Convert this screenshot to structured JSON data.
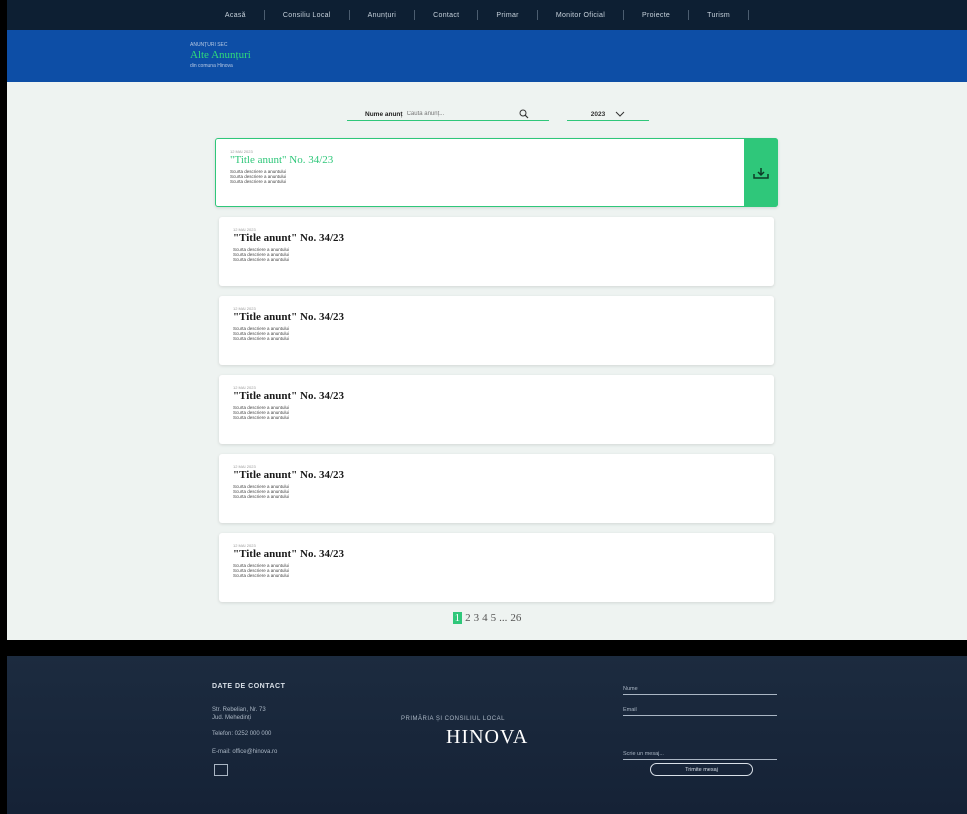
{
  "nav": [
    "Acasă",
    "Consiliu Local",
    "Anunțuri",
    "Contact",
    "Primar",
    "Monitor Oficial",
    "Proiecte",
    "Turism"
  ],
  "hero": {
    "kicker": "ANUNȚURI SEC",
    "title": "Alte Anunțuri",
    "sub": "din comuna Hinova"
  },
  "search": {
    "label": "Nume anunț",
    "placeholder": "Caută anunț..."
  },
  "year": "2023",
  "cards": [
    {
      "date": "12 MAI 2023",
      "title": "\"Title anunt\" No. 34/23",
      "desc": [
        "Scurta descriere a anuntului",
        "Scurta descriere a anuntului",
        "Scurta descriere a anuntului"
      ]
    },
    {
      "date": "12 MAI 2023",
      "title": "\"Title anunt\" No. 34/23",
      "desc": [
        "Scurta descriere a anuntului",
        "Scurta descriere a anuntului",
        "Scurta descriere a anuntului"
      ]
    },
    {
      "date": "12 MAI 2023",
      "title": "\"Title anunt\" No. 34/23",
      "desc": [
        "Scurta descriere a anuntului",
        "Scurta descriere a anuntului",
        "Scurta descriere a anuntului"
      ]
    },
    {
      "date": "12 MAI 2023",
      "title": "\"Title anunt\" No. 34/23",
      "desc": [
        "Scurta descriere a anuntului",
        "Scurta descriere a anuntului",
        "Scurta descriere a anuntului"
      ]
    },
    {
      "date": "12 MAI 2023",
      "title": "\"Title anunt\" No. 34/23",
      "desc": [
        "Scurta descriere a anuntului",
        "Scurta descriere a anuntului",
        "Scurta descriere a anuntului"
      ]
    },
    {
      "date": "12 MAI 2023",
      "title": "\"Title anunt\" No. 34/23",
      "desc": [
        "Scurta descriere a anuntului",
        "Scurta descriere a anuntului",
        "Scurta descriere a anuntului"
      ]
    }
  ],
  "pagination": [
    "1",
    "2",
    "3",
    "4",
    "5",
    "...",
    "26"
  ],
  "footer": {
    "contact_heading": "DATE DE CONTACT",
    "address": [
      "Str. Rebelian, Nr. 73",
      "Jud. Mehedinți"
    ],
    "phone": "Telefon: 0252 000 000",
    "email": "E-mail: office@hinova.ro",
    "org": "PRIMĂRIA ȘI CONSILIUL LOCAL",
    "brand": "HINOVA",
    "field_name": "Nume",
    "field_email": "Email",
    "field_message": "Scrie un mesaj...",
    "send": "Trimite mesaj"
  },
  "colors": {
    "accent": "#2fc77a",
    "navy": "#0d1f33",
    "hero": "#0d4ea6"
  }
}
